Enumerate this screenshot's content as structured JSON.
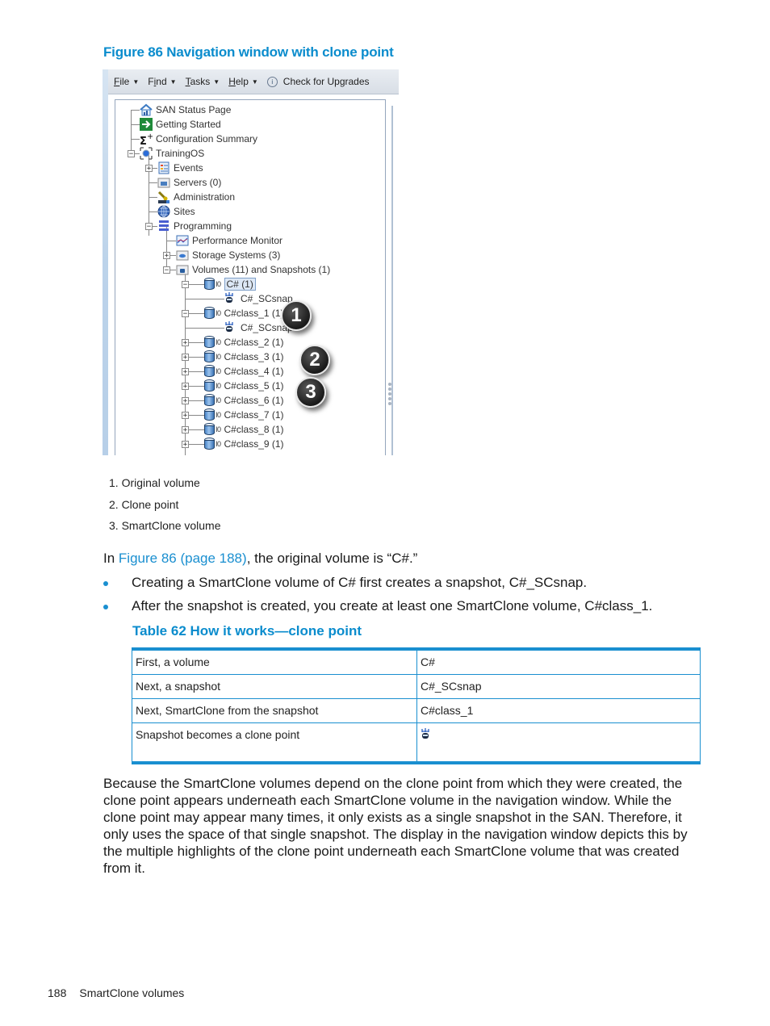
{
  "figure": {
    "caption": "Figure 86 Navigation window with clone point",
    "menubar": {
      "items": [
        {
          "label": "File",
          "underline": "F",
          "rest": "ile",
          "has_dropdown": true
        },
        {
          "label": "Find",
          "underline": "i",
          "pre": "F",
          "rest": "nd",
          "has_dropdown": true
        },
        {
          "label": "Tasks",
          "underline": "T",
          "rest": "asks",
          "has_dropdown": true
        },
        {
          "label": "Help",
          "underline": "H",
          "rest": "elp",
          "has_dropdown": true
        }
      ],
      "check_upgrades": "Check for Upgrades"
    },
    "tree": [
      {
        "label": "SAN Status Page",
        "icon": "san-status-icon",
        "level": 0
      },
      {
        "label": "Getting Started",
        "icon": "getting-started-icon",
        "level": 0
      },
      {
        "label": "Configuration Summary",
        "icon": "sigma-plus-icon",
        "level": 0
      },
      {
        "label": "TrainingOS",
        "icon": "management-group-icon",
        "level": 0,
        "expanded": true
      },
      {
        "label": "Events",
        "icon": "events-icon",
        "level": 1,
        "collapsed": true
      },
      {
        "label": "Servers (0)",
        "icon": "servers-folder-icon",
        "level": 1
      },
      {
        "label": "Administration",
        "icon": "administration-icon",
        "level": 1
      },
      {
        "label": "Sites",
        "icon": "globe-icon",
        "level": 1
      },
      {
        "label": "Programming",
        "icon": "cluster-icon",
        "level": 1,
        "expanded": true
      },
      {
        "label": "Performance Monitor",
        "icon": "performance-monitor-icon",
        "level": 2
      },
      {
        "label": "Storage Systems (3)",
        "icon": "storage-systems-icon",
        "level": 2,
        "collapsed": true
      },
      {
        "label": "Volumes (11) and Snapshots (1)",
        "icon": "volumes-folder-icon",
        "level": 2,
        "expanded": true
      },
      {
        "label": "C# (1)",
        "icon": "volume-icon",
        "level": 3,
        "expanded": true,
        "selected": true
      },
      {
        "label": "C#_SCsnap",
        "icon": "clone-point-icon",
        "level": 4
      },
      {
        "label": "C#class_1 (1)",
        "icon": "volume-icon",
        "level": 3,
        "expanded": true
      },
      {
        "label": "C#_SCsnap",
        "icon": "clone-point-icon",
        "level": 4
      },
      {
        "label": "C#class_2 (1)",
        "icon": "volume-icon",
        "level": 3,
        "collapsed": true
      },
      {
        "label": "C#class_3 (1)",
        "icon": "volume-icon",
        "level": 3,
        "collapsed": true
      },
      {
        "label": "C#class_4 (1)",
        "icon": "volume-icon",
        "level": 3,
        "collapsed": true
      },
      {
        "label": "C#class_5 (1)",
        "icon": "volume-icon",
        "level": 3,
        "collapsed": true
      },
      {
        "label": "C#class_6 (1)",
        "icon": "volume-icon",
        "level": 3,
        "collapsed": true
      },
      {
        "label": "C#class_7 (1)",
        "icon": "volume-icon",
        "level": 3,
        "collapsed": true
      },
      {
        "label": "C#class_8 (1)",
        "icon": "volume-icon",
        "level": 3,
        "collapsed": true
      },
      {
        "label": "C#class_9 (1)",
        "icon": "volume-icon",
        "level": 3,
        "collapsed": true
      }
    ],
    "volume_io_label": "I0",
    "callouts": [
      "1",
      "2",
      "3"
    ]
  },
  "legend": [
    "1. Original volume",
    "2. Clone point",
    "3. SmartClone volume"
  ],
  "intro": {
    "prefix": "In ",
    "link": "Figure 86 (page 188)",
    "suffix": ", the original volume is “C#.”"
  },
  "bullets": [
    "Creating a SmartClone volume of C# first creates a snapshot, C#_SCsnap.",
    "After the snapshot is created, you create at least one SmartClone volume, C#class_1."
  ],
  "table": {
    "caption": "Table 62 How it works—clone point",
    "rows": [
      {
        "step": "First, a volume",
        "value": "C#"
      },
      {
        "step": "Next, a snapshot",
        "value": "C#_SCsnap"
      },
      {
        "step": "Next, SmartClone from the snapshot",
        "value": "C#class_1"
      },
      {
        "step": "Snapshot becomes a clone point",
        "value_icon": "clone-point-icon"
      }
    ]
  },
  "body_paragraph": "Because the SmartClone volumes depend on the clone point from which they were created, the clone point appears underneath each SmartClone volume in the navigation window. While the clone point may appear many times, it only exists as a single snapshot in the SAN. Therefore, it only uses the space of that single snapshot. The display in the navigation window depicts this by the multiple highlights of the clone point underneath each SmartClone volume that was created from it.",
  "footer": {
    "page_number": "188",
    "section": "SmartClone volumes"
  },
  "colors": {
    "accent": "#0a8ccd",
    "link": "#1a8fd0",
    "table_border": "#1a8fd0"
  }
}
